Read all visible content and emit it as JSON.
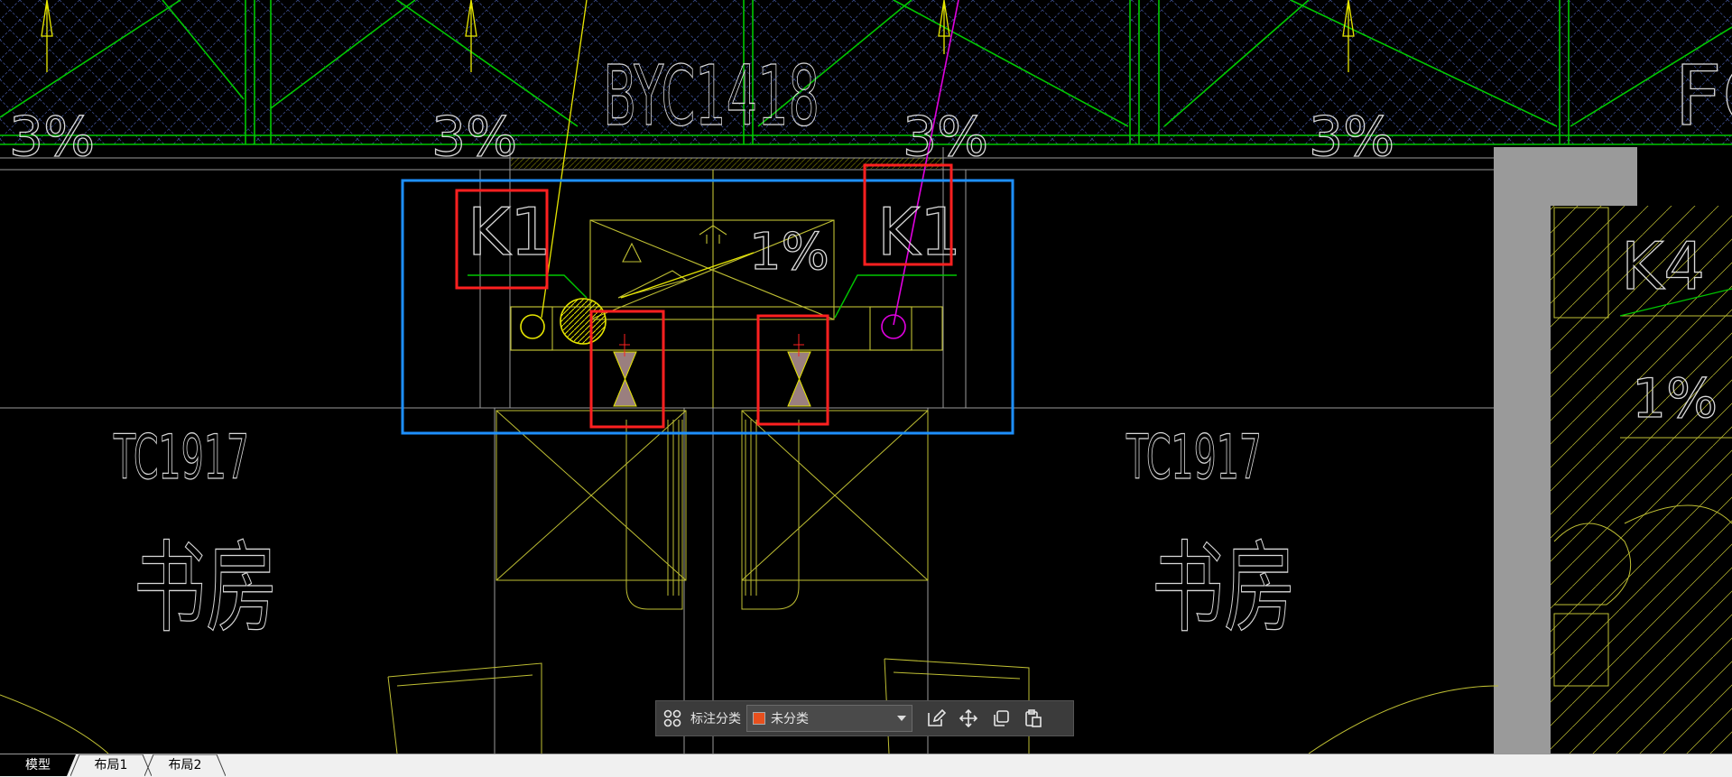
{
  "drawing": {
    "window_label": "BYC1418",
    "slopes": [
      "3%",
      "3%",
      "3%",
      "3%"
    ],
    "slope_right": "1%",
    "slope_box": "1%",
    "partial_label": "FC",
    "units": [
      "K1",
      "K1",
      "K4"
    ],
    "window_labels": [
      "TC1917",
      "TC1917"
    ],
    "room_names": [
      "书房",
      "书房"
    ],
    "colors": {
      "highlight_red": "#ff2020",
      "selection_blue": "#1e90ff",
      "line_green": "#00c800",
      "line_yellow": "#e6e600",
      "line_magenta": "#e000e0",
      "hatch_blue": "#3c4d8c",
      "wall_gray": "#9a9a9a"
    }
  },
  "toolbar": {
    "category_label": "标注分类",
    "category_value": "未分类",
    "category_color": "#e8501e",
    "icons": [
      "grid-icon",
      "edit-icon",
      "move-icon",
      "copy-icon",
      "paste-icon"
    ]
  },
  "tabs": [
    {
      "label": "模型",
      "active": true
    },
    {
      "label": "布局1",
      "active": false
    },
    {
      "label": "布局2",
      "active": false
    }
  ]
}
